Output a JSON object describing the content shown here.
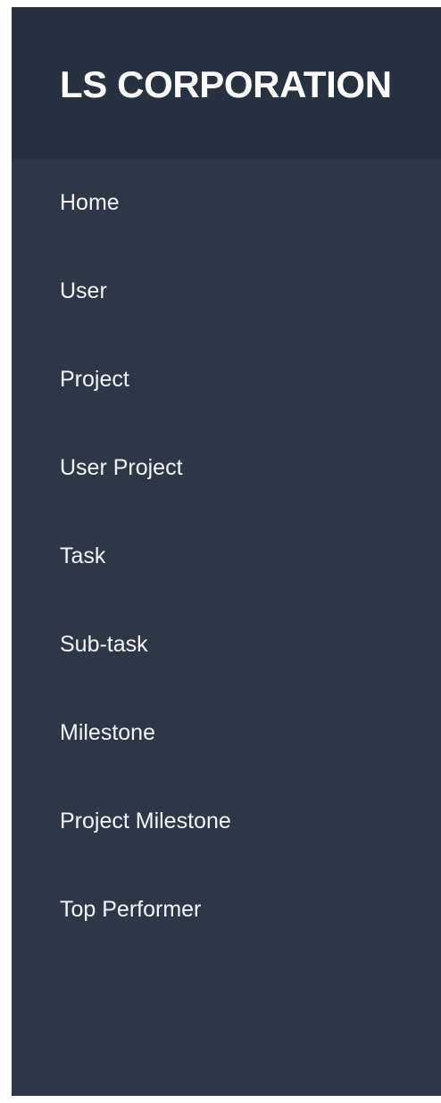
{
  "sidebar": {
    "brand": "LS CORPORATION",
    "items": [
      {
        "label": "Home"
      },
      {
        "label": "User"
      },
      {
        "label": "Project"
      },
      {
        "label": "User Project"
      },
      {
        "label": "Task"
      },
      {
        "label": "Sub-task"
      },
      {
        "label": "Milestone"
      },
      {
        "label": "Project Milestone"
      },
      {
        "label": "Top Performer"
      }
    ]
  },
  "colors": {
    "sidebar_background": "#2e3747",
    "brand_background": "#283140",
    "text": "#ffffff"
  }
}
